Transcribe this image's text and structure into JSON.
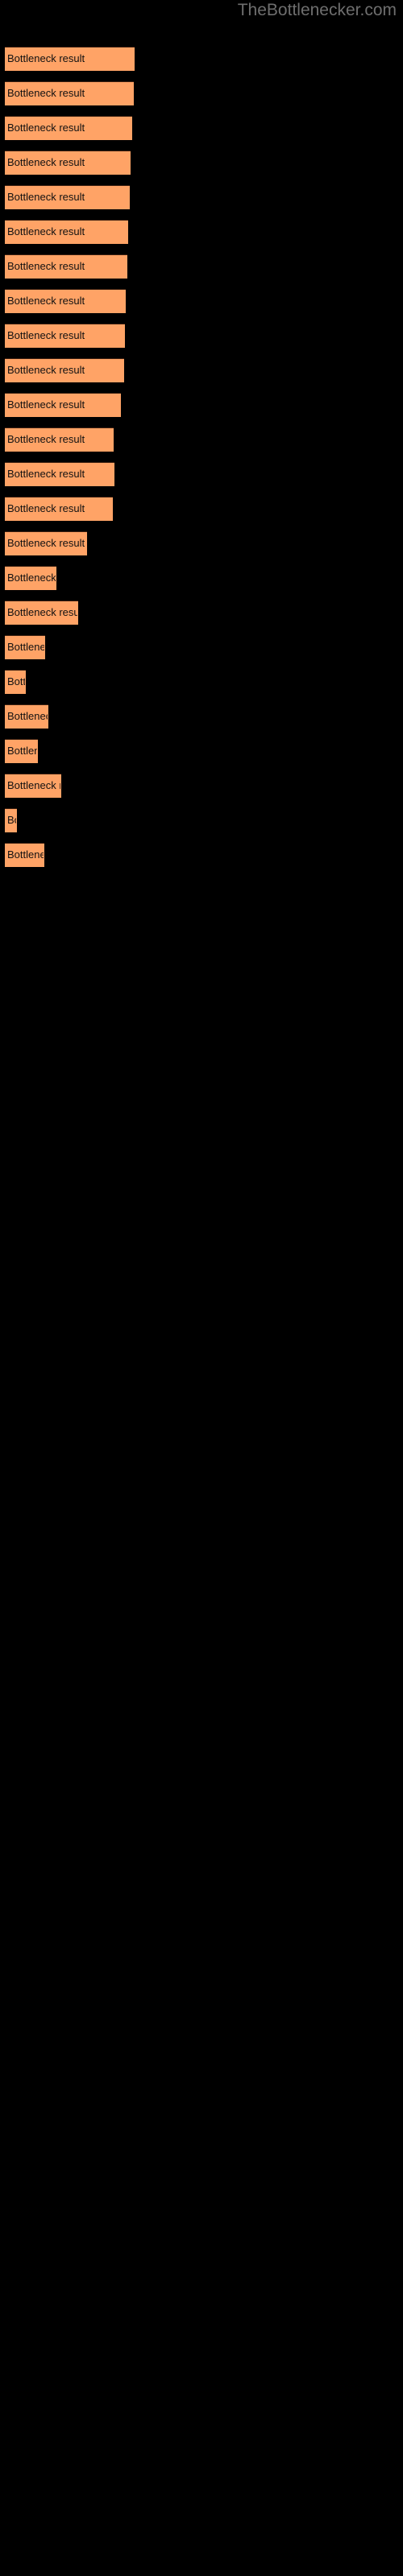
{
  "site": {
    "title": "TheBottlenecker.com"
  },
  "theme": {
    "background": "#000000",
    "bar_color": "#FFA366",
    "bar_border": "#3a1f10",
    "label_color": "#111111",
    "title_color": "#6e6e6e"
  },
  "chart_data": {
    "type": "bar",
    "orientation": "horizontal",
    "title": "TheBottlenecker.com",
    "xlabel": "",
    "ylabel": "",
    "grid": false,
    "legend": null,
    "bar_label_text": "Bottleneck result",
    "categories": [
      "Bottleneck result",
      "Bottleneck result",
      "Bottleneck result",
      "Bottleneck result",
      "Bottleneck result",
      "Bottleneck result",
      "Bottleneck result",
      "Bottleneck result",
      "Bottleneck result",
      "Bottleneck result",
      "Bottleneck result",
      "Bottleneck result",
      "Bottleneck result",
      "Bottleneck result",
      "Bottleneck result",
      "Bottleneck result",
      "Bottleneck result",
      "Bottleneck result",
      "Bottleneck result",
      "Bottleneck result",
      "Bottleneck result",
      "Bottleneck result",
      "Bottleneck result",
      "Bottleneck result"
    ],
    "values": [
      161,
      160,
      158,
      156,
      155,
      153,
      152,
      150,
      149,
      148,
      144,
      135,
      136,
      134,
      102,
      64,
      91,
      50,
      26,
      54,
      41,
      70,
      15,
      49
    ],
    "xlim": [
      0,
      161
    ],
    "bar_tops": [
      58,
      101,
      144,
      187,
      230,
      273,
      316,
      359,
      402,
      445,
      488,
      531,
      574,
      617,
      660,
      703,
      746,
      789,
      832,
      875,
      918,
      961,
      1004,
      1047
    ]
  }
}
